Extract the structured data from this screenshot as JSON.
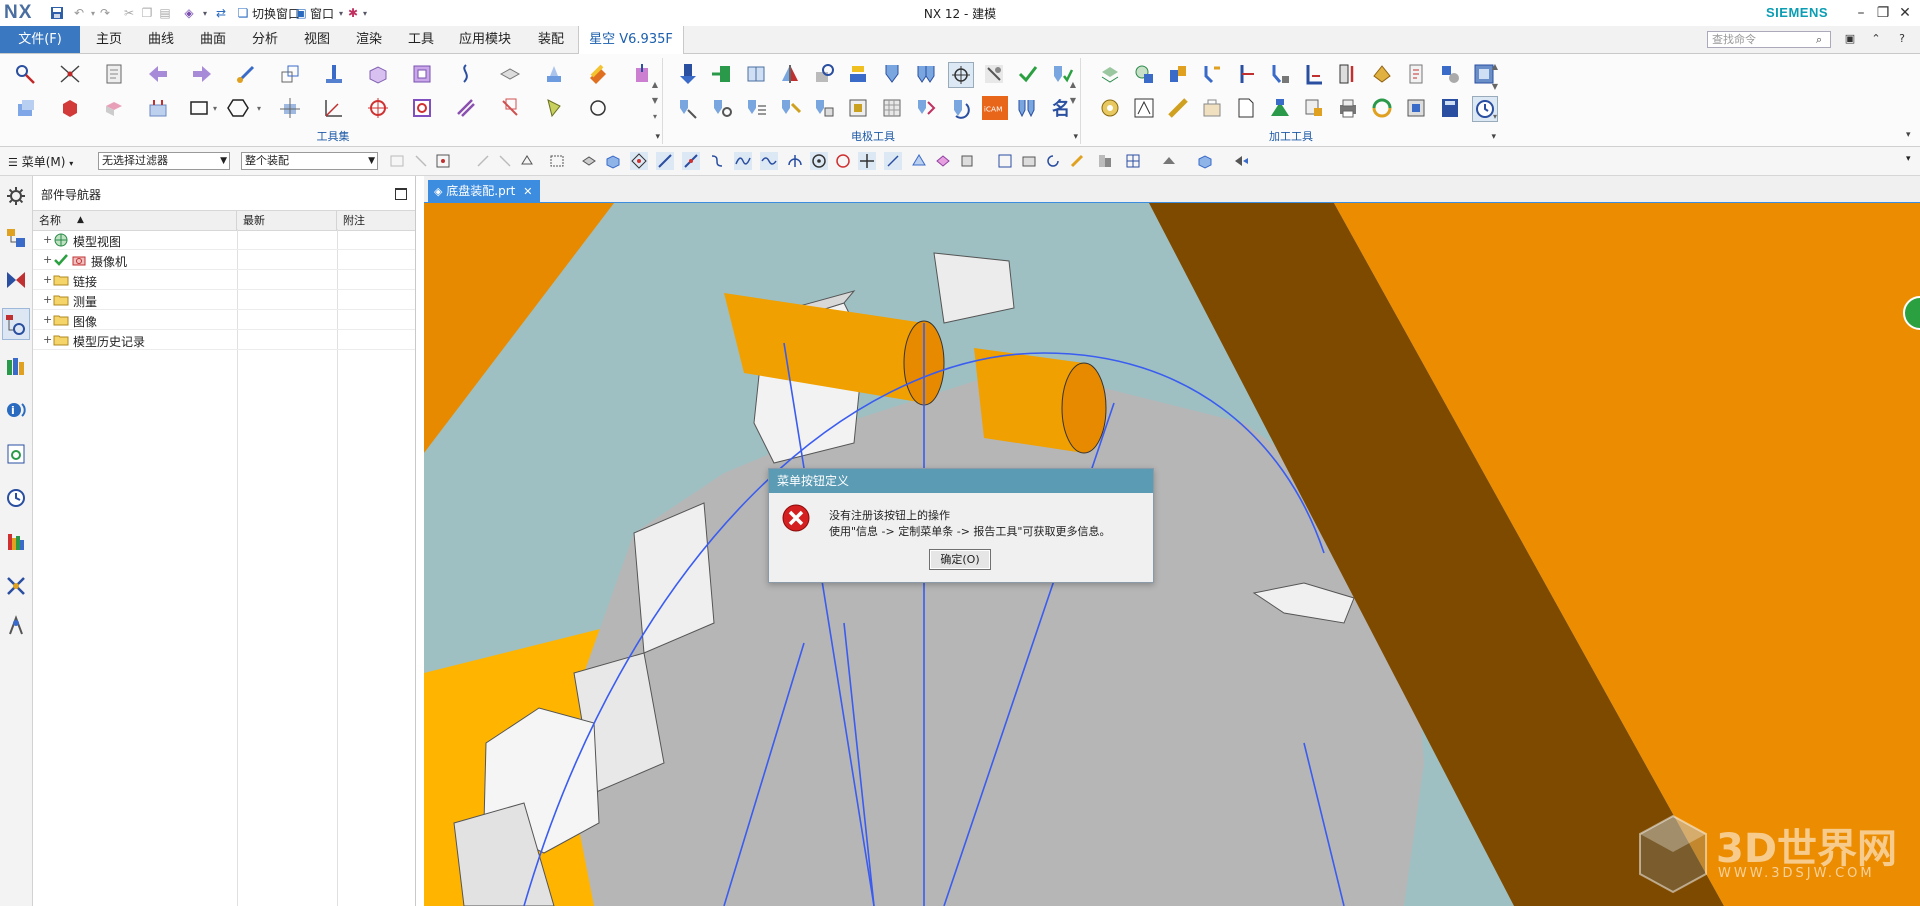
{
  "window": {
    "logo": "NX",
    "title": "NX 12 - 建模",
    "brand": "SIEMENS",
    "switch_window": "切换窗口",
    "window_menu": "窗口"
  },
  "tabs": [
    {
      "label": "文件(F)"
    },
    {
      "label": "主页"
    },
    {
      "label": "曲线"
    },
    {
      "label": "曲面"
    },
    {
      "label": "分析"
    },
    {
      "label": "视图"
    },
    {
      "label": "渲染"
    },
    {
      "label": "工具"
    },
    {
      "label": "应用模块"
    },
    {
      "label": "装配"
    },
    {
      "label": "星空 V6.935F",
      "active": true
    }
  ],
  "search": {
    "placeholder": "查找命令"
  },
  "ribbon": {
    "groups": [
      {
        "label": "工具集"
      },
      {
        "label": "电极工具"
      },
      {
        "label": "加工工具"
      }
    ],
    "special_icon_text": "iCAM",
    "name_icon_text": "名"
  },
  "selection_bar": {
    "menu_label": "菜单(M)",
    "filter": "无选择过滤器",
    "scope": "整个装配"
  },
  "navigator": {
    "title": "部件导航器",
    "columns": [
      "名称",
      "最新",
      "附注"
    ],
    "items": [
      {
        "label": "模型视图",
        "icon": "model-views-icon"
      },
      {
        "label": "摄像机",
        "icon": "camera-icon"
      },
      {
        "label": "链接",
        "icon": "folder-icon"
      },
      {
        "label": "测量",
        "icon": "folder-icon"
      },
      {
        "label": "图像",
        "icon": "folder-icon"
      },
      {
        "label": "模型历史记录",
        "icon": "folder-icon"
      }
    ]
  },
  "view_tab": {
    "label": "底盘装配.prt"
  },
  "dialog": {
    "title": "菜单按钮定义",
    "line1": "没有注册该按钮上的操作",
    "line2": "使用\"信息 -> 定制菜单条 -> 报告工具\"可获取更多信息。",
    "ok_label": "确定(O)"
  },
  "watermark": {
    "text": "3D世界网",
    "sub": "WWW.3DSJW.COM"
  },
  "colors": {
    "accent_blue": "#3c8ce0",
    "dialog_title": "#5b9bb4",
    "part_orange": "#e88a00",
    "part_brown": "#7d4a00",
    "gear_gray": "#b6b6b6",
    "curve_blue": "#3a5cf0"
  }
}
